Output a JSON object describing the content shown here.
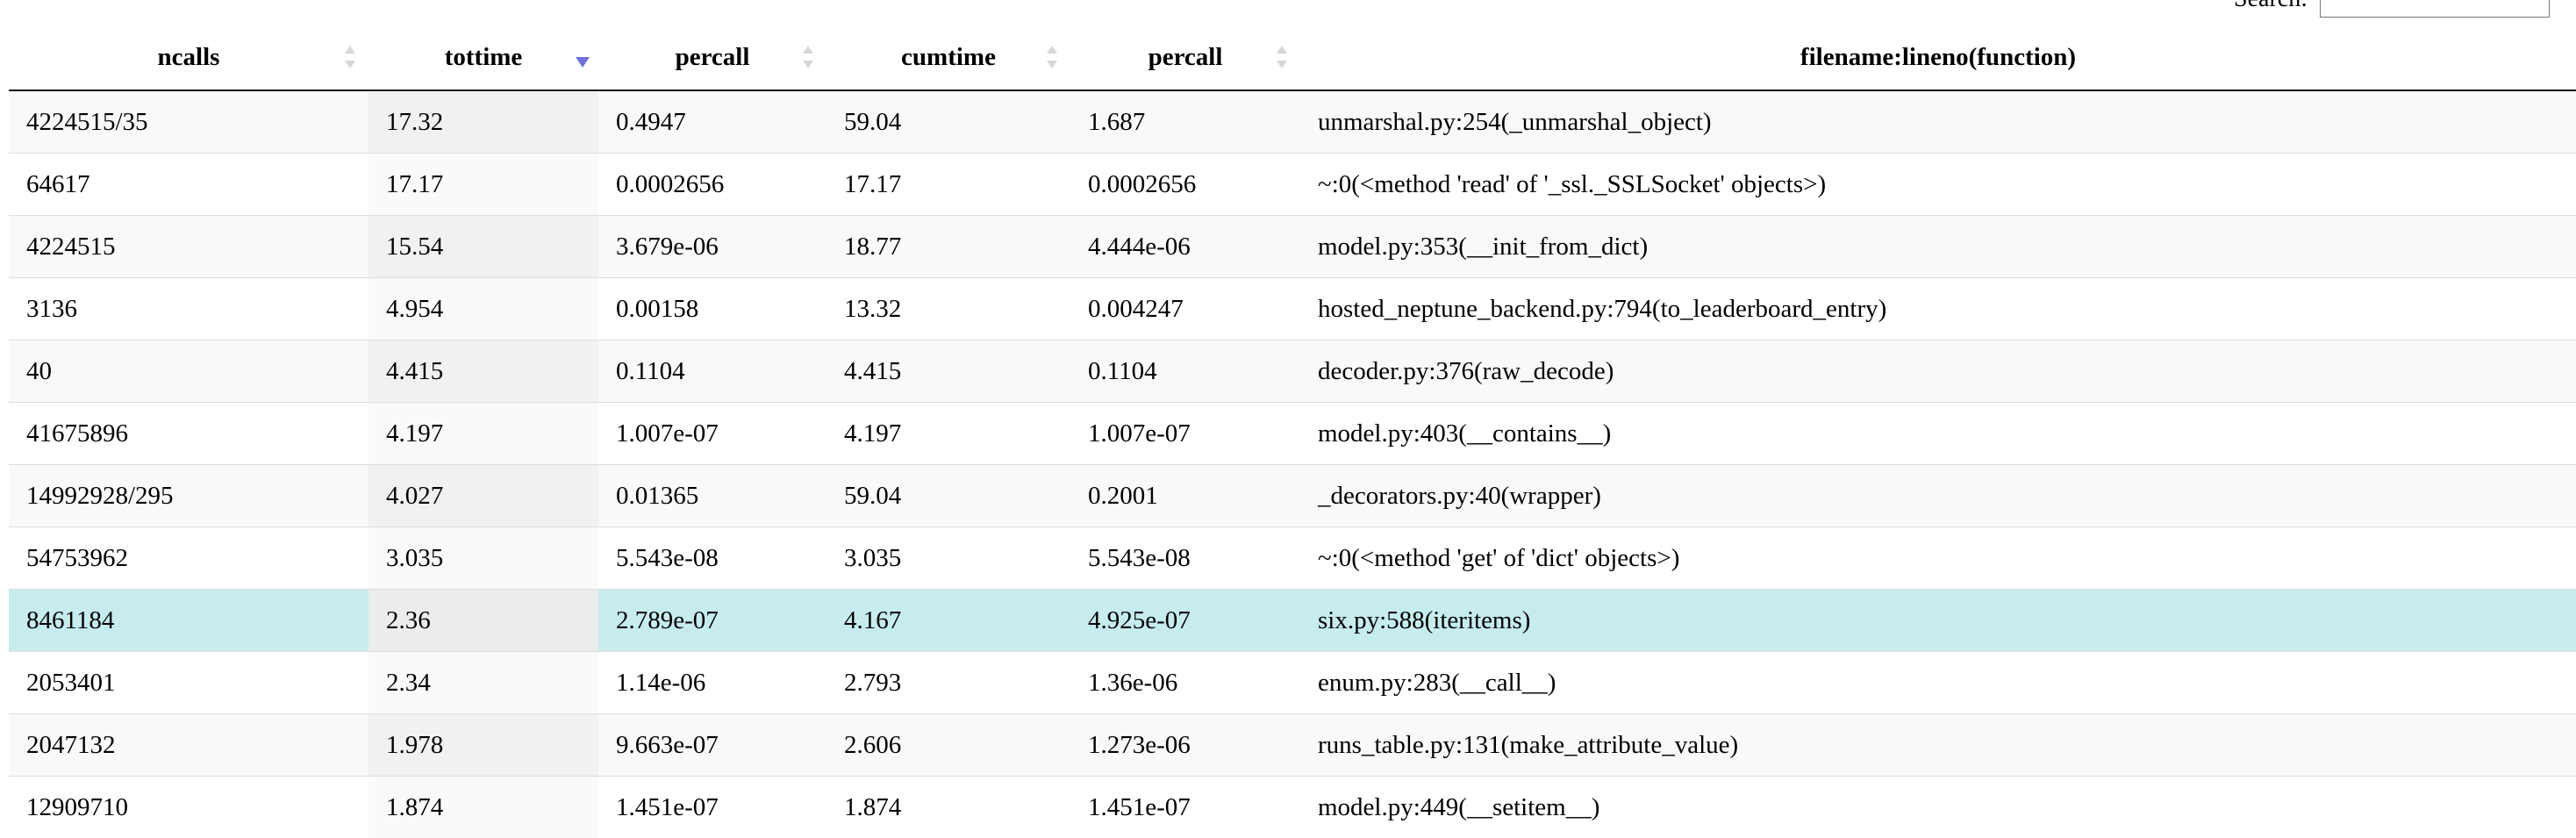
{
  "search": {
    "label": "Search:",
    "value": "",
    "placeholder": ""
  },
  "columns": [
    {
      "label": "ncalls",
      "sort": "none"
    },
    {
      "label": "tottime",
      "sort": "desc"
    },
    {
      "label": "percall",
      "sort": "none"
    },
    {
      "label": "cumtime",
      "sort": "none"
    },
    {
      "label": "percall",
      "sort": "none"
    },
    {
      "label": "filename:lineno(function)",
      "sort": "none"
    }
  ],
  "rows": [
    {
      "ncalls": "4224515/35",
      "tottime": "17.32",
      "percall": "0.4947",
      "cumtime": "59.04",
      "percall_cum": "1.687",
      "function": "unmarshal.py:254(_unmarshal_object)",
      "selected": false
    },
    {
      "ncalls": "64617",
      "tottime": "17.17",
      "percall": "0.0002656",
      "cumtime": "17.17",
      "percall_cum": "0.0002656",
      "function": "~:0(<method 'read' of '_ssl._SSLSocket' objects>)",
      "selected": false
    },
    {
      "ncalls": "4224515",
      "tottime": "15.54",
      "percall": "3.679e-06",
      "cumtime": "18.77",
      "percall_cum": "4.444e-06",
      "function": "model.py:353(__init_from_dict)",
      "selected": false
    },
    {
      "ncalls": "3136",
      "tottime": "4.954",
      "percall": "0.00158",
      "cumtime": "13.32",
      "percall_cum": "0.004247",
      "function": "hosted_neptune_backend.py:794(to_leaderboard_entry)",
      "selected": false
    },
    {
      "ncalls": "40",
      "tottime": "4.415",
      "percall": "0.1104",
      "cumtime": "4.415",
      "percall_cum": "0.1104",
      "function": "decoder.py:376(raw_decode)",
      "selected": false
    },
    {
      "ncalls": "41675896",
      "tottime": "4.197",
      "percall": "1.007e-07",
      "cumtime": "4.197",
      "percall_cum": "1.007e-07",
      "function": "model.py:403(__contains__)",
      "selected": false
    },
    {
      "ncalls": "14992928/295",
      "tottime": "4.027",
      "percall": "0.01365",
      "cumtime": "59.04",
      "percall_cum": "0.2001",
      "function": "_decorators.py:40(wrapper)",
      "selected": false
    },
    {
      "ncalls": "54753962",
      "tottime": "3.035",
      "percall": "5.543e-08",
      "cumtime": "3.035",
      "percall_cum": "5.543e-08",
      "function": "~:0(<method 'get' of 'dict' objects>)",
      "selected": false
    },
    {
      "ncalls": "8461184",
      "tottime": "2.36",
      "percall": "2.789e-07",
      "cumtime": "4.167",
      "percall_cum": "4.925e-07",
      "function": "six.py:588(iteritems)",
      "selected": true
    },
    {
      "ncalls": "2053401",
      "tottime": "2.34",
      "percall": "1.14e-06",
      "cumtime": "2.793",
      "percall_cum": "1.36e-06",
      "function": "enum.py:283(__call__)",
      "selected": false
    },
    {
      "ncalls": "2047132",
      "tottime": "1.978",
      "percall": "9.663e-07",
      "cumtime": "2.606",
      "percall_cum": "1.273e-06",
      "function": "runs_table.py:131(make_attribute_value)",
      "selected": false
    },
    {
      "ncalls": "12909710",
      "tottime": "1.874",
      "percall": "1.451e-07",
      "cumtime": "1.874",
      "percall_cum": "1.451e-07",
      "function": "model.py:449(__setitem__)",
      "selected": false
    }
  ],
  "colors": {
    "selected_row": "#c6ecee",
    "sort_active": "#6f6fe0",
    "sort_inactive": "#d7d7d7"
  }
}
